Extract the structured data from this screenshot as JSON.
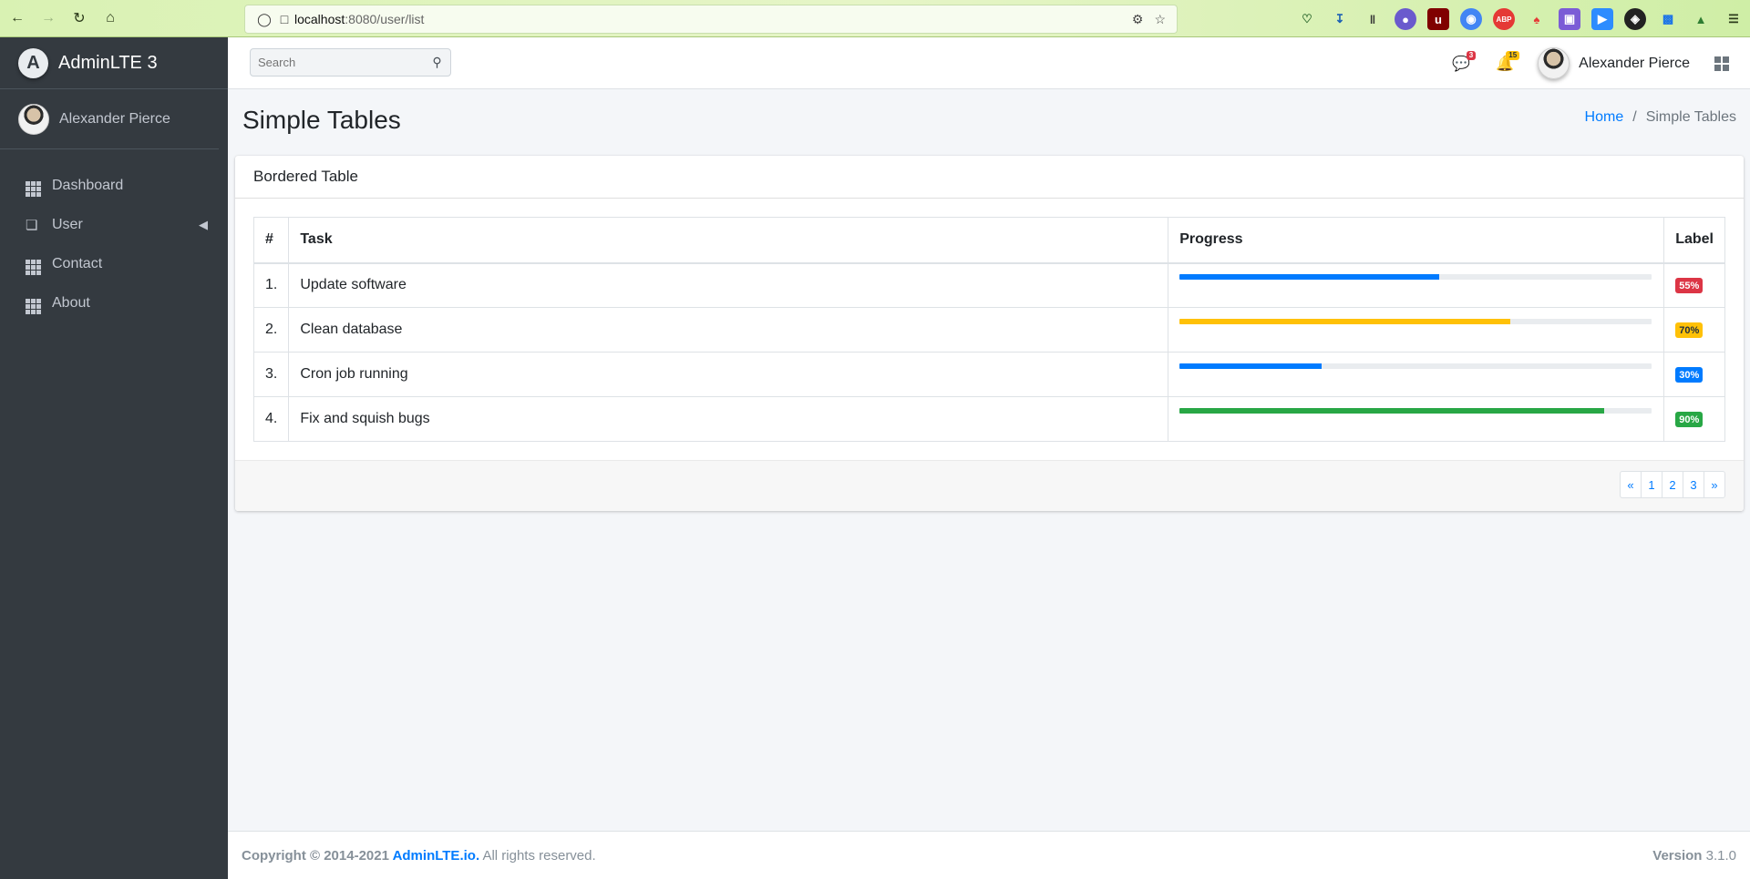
{
  "browser": {
    "url_host": "localhost",
    "url_path": ":8080/user/list",
    "back_icon": "arrow-left-icon",
    "forward_icon": "arrow-right-icon",
    "reload_icon": "reload-icon",
    "home_icon": "home-icon"
  },
  "sidebar": {
    "brand": "AdminLTE 3",
    "user_name": "Alexander Pierce",
    "items": [
      {
        "label": "Dashboard",
        "icon": "grid-icon"
      },
      {
        "label": "User",
        "icon": "copy-icon",
        "has_submenu": true
      },
      {
        "label": "Contact",
        "icon": "grid-icon"
      },
      {
        "label": "About",
        "icon": "grid-icon"
      }
    ]
  },
  "navbar": {
    "search_placeholder": "Search",
    "messages_count": "3",
    "notifications_count": "15",
    "user_name": "Alexander Pierce"
  },
  "header": {
    "title": "Simple Tables",
    "breadcrumb_home": "Home",
    "breadcrumb_sep": "/",
    "breadcrumb_active": "Simple Tables"
  },
  "card": {
    "title": "Bordered Table",
    "columns": [
      "#",
      "Task",
      "Progress",
      "Label"
    ],
    "rows": [
      {
        "num": "1.",
        "task": "Update software",
        "progress": 0.55,
        "color": "#007bff",
        "label": "55%",
        "label_color": "#dc3545"
      },
      {
        "num": "2.",
        "task": "Clean database",
        "progress": 0.7,
        "color": "#ffc107",
        "label": "70%",
        "label_color": "#ffc107"
      },
      {
        "num": "3.",
        "task": "Cron job running",
        "progress": 0.3,
        "color": "#007bff",
        "label": "30%",
        "label_color": "#007bff"
      },
      {
        "num": "4.",
        "task": "Fix and squish bugs",
        "progress": 0.9,
        "color": "#28a745",
        "label": "90%",
        "label_color": "#28a745"
      }
    ],
    "pagination": [
      "«",
      "1",
      "2",
      "3",
      "»"
    ]
  },
  "footer": {
    "copyright_prefix": "Copyright © 2014-2021 ",
    "copyright_link": "AdminLTE.io.",
    "copyright_suffix": " All rights reserved.",
    "version_label": "Version",
    "version_number": " 3.1.0"
  },
  "colors": {
    "sidebar_bg": "#343a40",
    "primary": "#007bff",
    "danger": "#dc3545",
    "warning": "#ffc107",
    "success": "#28a745"
  }
}
